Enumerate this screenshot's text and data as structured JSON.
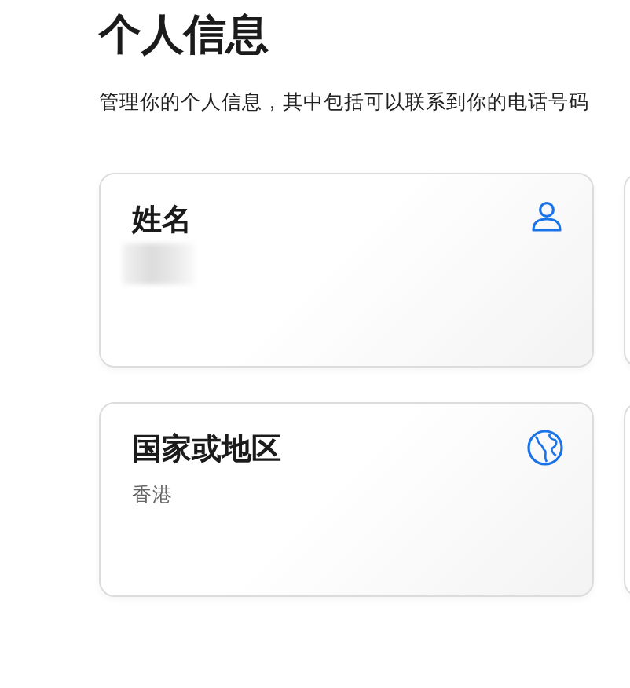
{
  "title": "个人信息",
  "subtitle": "管理你的个人信息，其中包括可以联系到你的电话号码",
  "cards": [
    {
      "kind": "name",
      "label": "姓名"
    },
    {
      "kind": "region",
      "label": "国家或地区",
      "value": "香港"
    }
  ]
}
